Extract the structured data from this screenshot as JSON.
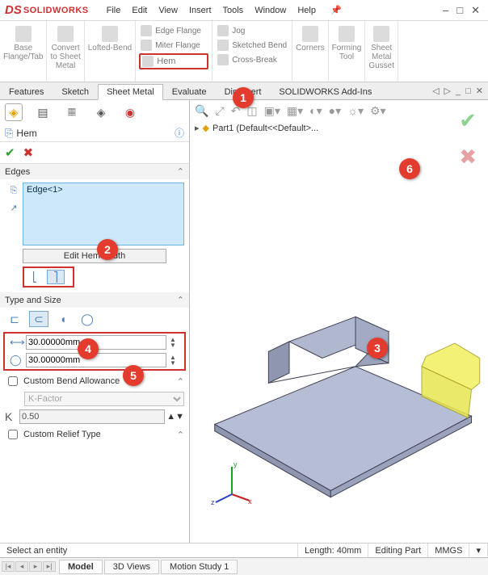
{
  "app": {
    "name": "SOLIDWORKS",
    "logo_prefix": "DS"
  },
  "menu": {
    "file": "File",
    "edit": "Edit",
    "view": "View",
    "insert": "Insert",
    "tools": "Tools",
    "window": "Window",
    "help": "Help"
  },
  "ribbon": {
    "base": "Base\nFlange/Tab",
    "convert": "Convert\nto Sheet\nMetal",
    "lofted": "Lofted-Bend",
    "edge_flange": "Edge Flange",
    "miter": "Miter Flange",
    "hem": "Hem",
    "jog": "Jog",
    "sketched": "Sketched Bend",
    "cross": "Cross-Break",
    "corners": "Corners",
    "forming": "Forming\nTool",
    "gusset": "Sheet\nMetal\nGusset"
  },
  "tabs": {
    "features": "Features",
    "sketch": "Sketch",
    "sheetmetal": "Sheet Metal",
    "evaluate": "Evaluate",
    "dimxpert": "DimXpert",
    "addins": "SOLIDWORKS Add-Ins"
  },
  "pm": {
    "title": "Hem",
    "edges_head": "Edges",
    "edge_item": "Edge<1>",
    "edit_hem": "Edit Hem Width",
    "type_head": "Type and Size",
    "val1": "30.00000mm",
    "val2": "30.00000mm",
    "cba": "Custom Bend Allowance",
    "kfactor_label": "K-Factor",
    "kfactor_value": "0.50",
    "k_letter": "K",
    "crt": "Custom Relief Type"
  },
  "tree": {
    "part": "Part1  (Default<<Default>..."
  },
  "viewtabs": {
    "model": "Model",
    "views3d": "3D Views",
    "motion": "Motion Study 1"
  },
  "status": {
    "hint": "Select an entity",
    "length": "Length: 40mm",
    "mode": "Editing Part",
    "units": "MMGS"
  },
  "callouts": {
    "c1": "1",
    "c2": "2",
    "c3": "3",
    "c4": "4",
    "c5": "5",
    "c6": "6"
  }
}
